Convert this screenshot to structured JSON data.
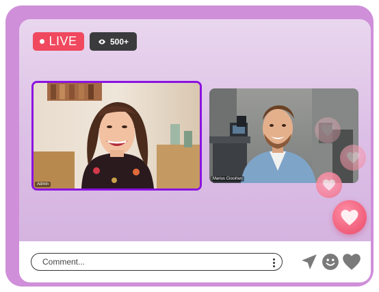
{
  "stream": {
    "live_label": "LIVE",
    "viewer_count": "500+"
  },
  "participants": [
    {
      "name": "Admin"
    },
    {
      "name": "Marius Ciocirlan"
    }
  ],
  "comment": {
    "placeholder": "Comment..."
  },
  "icons": {
    "viewers": "eye-icon",
    "more": "more-vertical-icon",
    "send": "send-icon",
    "emoji": "smile-icon",
    "like": "heart-icon"
  },
  "colors": {
    "frame": "#cf8fd9",
    "live_badge": "#f0485e",
    "viewer_badge": "#3b3b3d",
    "active_speaker_border": "#8a12e0",
    "heart": "#f2647f",
    "icons": "#7a7a7a"
  }
}
